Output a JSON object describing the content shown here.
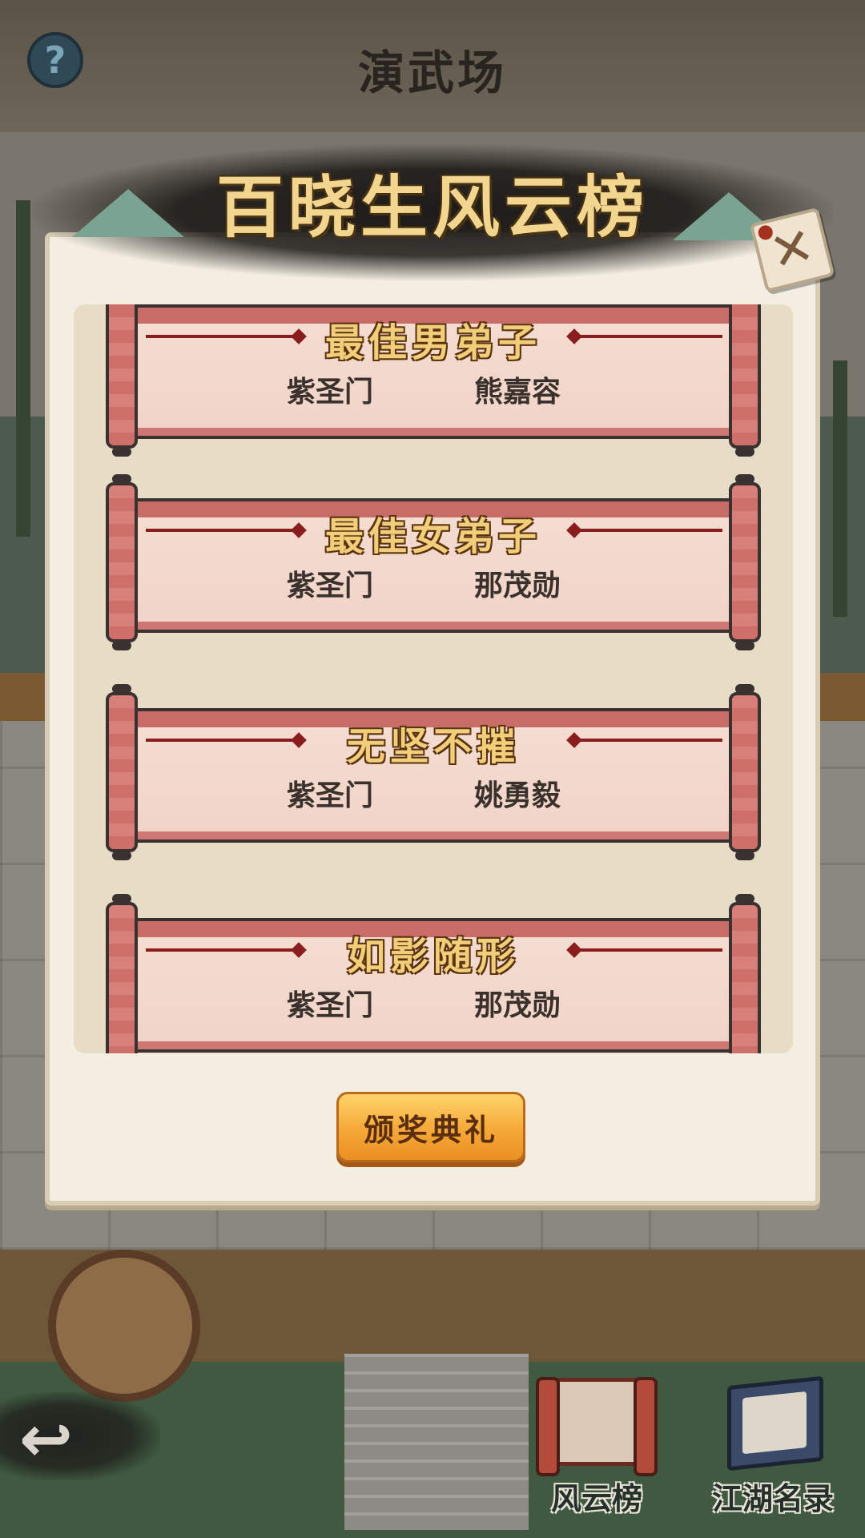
{
  "header": {
    "title": "演武场",
    "help_icon": "?"
  },
  "banner": {
    "title": "百晓生风云榜"
  },
  "close_icon": "✕",
  "awards": [
    {
      "title": "最佳男弟子",
      "sect": "紫圣门",
      "name": "熊嘉容"
    },
    {
      "title": "最佳女弟子",
      "sect": "紫圣门",
      "name": "那茂勋"
    },
    {
      "title": "无坚不摧",
      "sect": "紫圣门",
      "name": "姚勇毅"
    },
    {
      "title": "如影随形",
      "sect": "紫圣门",
      "name": "那茂勋"
    }
  ],
  "ceremony_button_label": "颁奖典礼",
  "bottom_nav": {
    "back_icon": "↩",
    "ranking_label": "风云榜",
    "roster_label": "江湖名录"
  }
}
